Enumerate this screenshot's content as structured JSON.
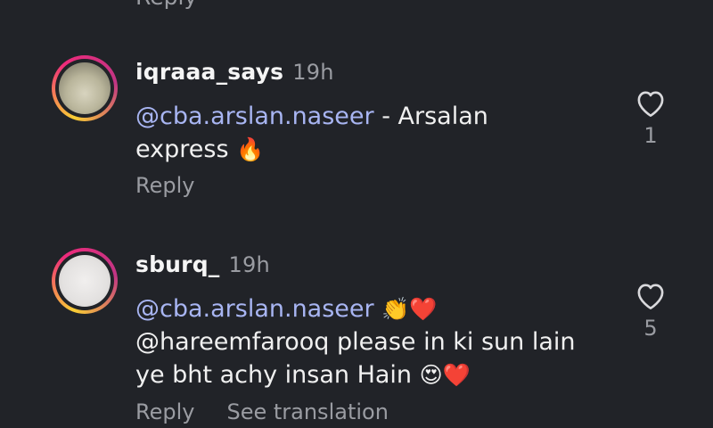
{
  "partial_top": {
    "reply_label": "Reply"
  },
  "comments": [
    {
      "username": "iqraaa_says",
      "time": "19h",
      "mention": "@cba.arslan.naseer",
      "text_line1": " - Arsalan",
      "text_line2": "express ",
      "emoji_end": "🔥",
      "reply_label": "Reply",
      "like_count": "1"
    },
    {
      "username": "sburq_",
      "time": "19h",
      "mention": "@cba.arslan.naseer",
      "emoji_after_mention": "👏❤️",
      "mention2": "@hareemfarooq",
      "text_line2": " please in ki sun lain",
      "text_line3": "ye bht achy insan Hain ",
      "emoji_end": "😍❤️",
      "reply_label": "Reply",
      "translation_label": "See translation",
      "like_count": "5"
    }
  ],
  "icons": {
    "like": "heart-outline-icon"
  }
}
